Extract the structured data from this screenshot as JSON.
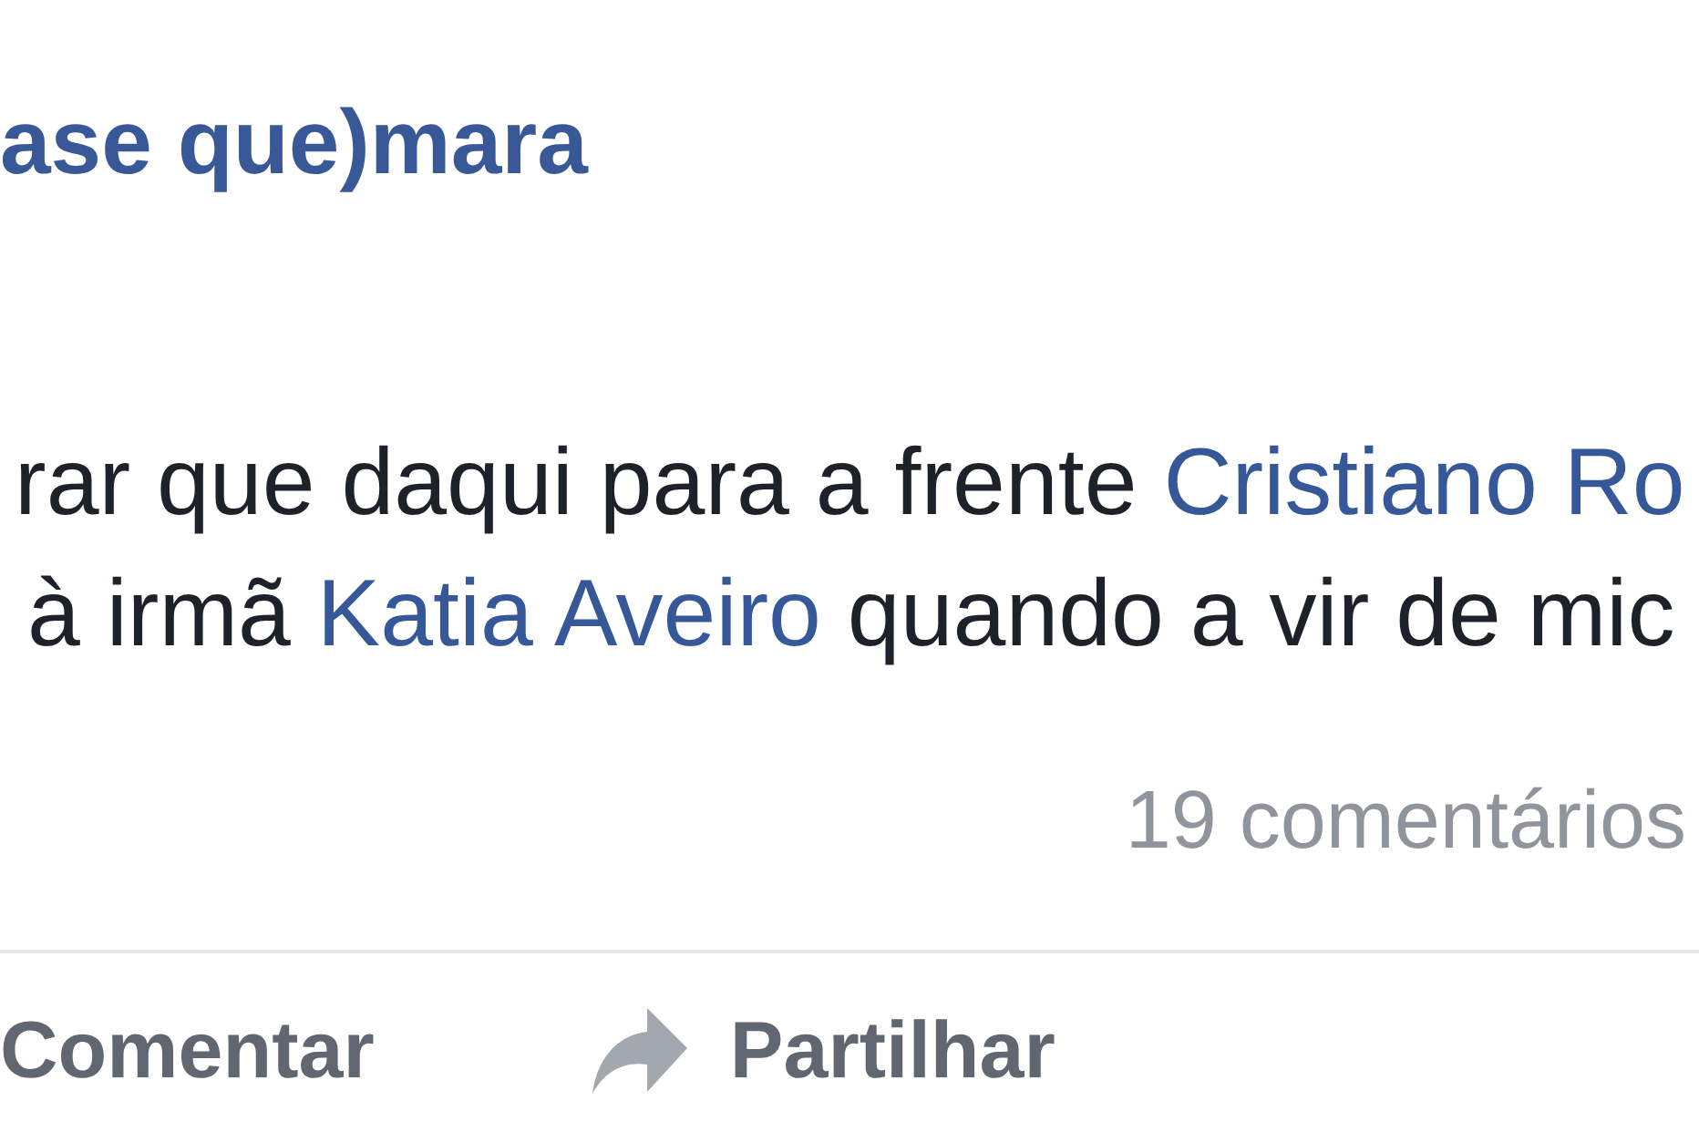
{
  "post": {
    "title": "ase que)mara",
    "body_lines": [
      [
        {
          "kind": "text",
          "text": "rar que daqui para a frente "
        },
        {
          "kind": "link",
          "text": "Cristiano Ro"
        }
      ],
      [
        {
          "kind": "text",
          "text": "à irmã "
        },
        {
          "kind": "link",
          "text": "Katia Aveiro"
        },
        {
          "kind": "text",
          "text": " quando a vir de mic"
        }
      ]
    ],
    "comment_count": "19 comentários"
  },
  "actions": [
    {
      "kind": "comment",
      "label": "Comentar"
    },
    {
      "kind": "share",
      "label": "Partilhar"
    }
  ]
}
